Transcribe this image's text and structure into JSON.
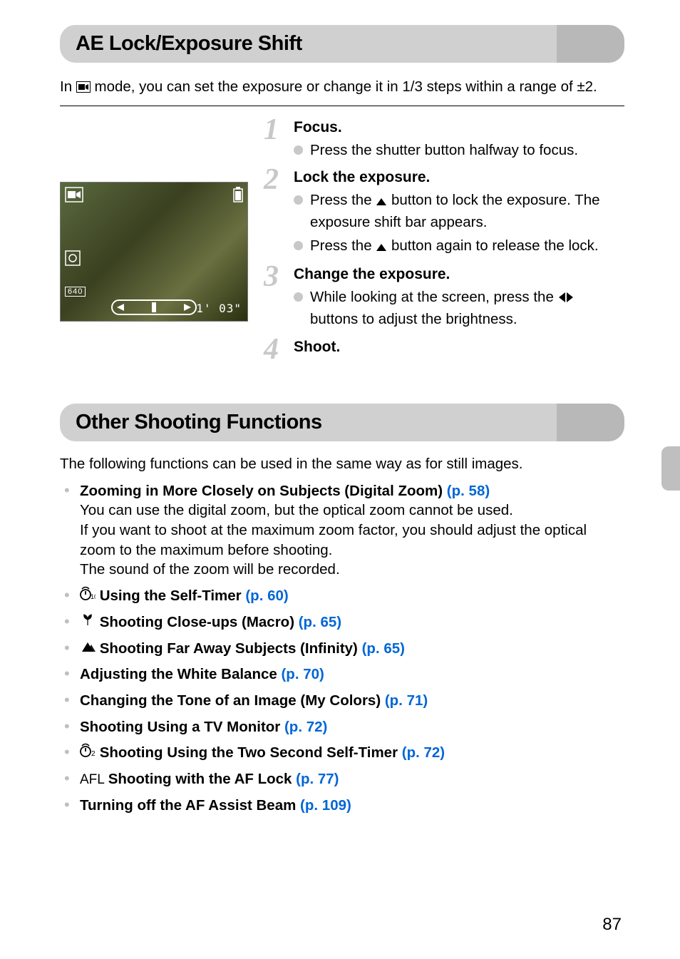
{
  "page_number": "87",
  "section1": {
    "heading": "AE Lock/Exposure Shift",
    "intro_pre": "In ",
    "intro_post": " mode, you can set the exposure or change it in 1/3 steps within a range of ±2.",
    "photo_time": "1' 03\"",
    "steps": [
      {
        "num": "1",
        "title": "Focus.",
        "bullets": [
          {
            "text": "Press the shutter button halfway to focus."
          }
        ]
      },
      {
        "num": "2",
        "title": "Lock the exposure.",
        "bullets": [
          {
            "pre": "Press the ",
            "post": " button to lock the exposure. The exposure shift bar appears.",
            "icon": "up"
          },
          {
            "pre": "Press the ",
            "post": " button again to release the lock.",
            "icon": "up"
          }
        ]
      },
      {
        "num": "3",
        "title": "Change the exposure.",
        "bullets": [
          {
            "pre": "While looking at the screen, press the ",
            "post": " buttons to adjust the brightness.",
            "icon": "leftright"
          }
        ]
      },
      {
        "num": "4",
        "title": "Shoot.",
        "bullets": []
      }
    ]
  },
  "section2": {
    "heading": "Other Shooting Functions",
    "intro": "The following functions can be used in the same way as for still images.",
    "items": [
      {
        "icon": "",
        "title": "Zooming in More Closely on Subjects (Digital Zoom) ",
        "link": "(p. 58)",
        "desc": "You can use the digital zoom, but the optical zoom cannot be used. If you want to shoot at the maximum zoom factor, you should adjust the optical zoom to the maximum before shooting.\nThe sound of the zoom will be recorded."
      },
      {
        "icon": "timer10",
        "title": " Using the Self-Timer ",
        "link": "(p. 60)"
      },
      {
        "icon": "macro",
        "title": " Shooting Close-ups (Macro) ",
        "link": "(p. 65)"
      },
      {
        "icon": "infinity",
        "title": " Shooting Far Away Subjects (Infinity) ",
        "link": "(p. 65)"
      },
      {
        "icon": "",
        "title": "Adjusting the White Balance ",
        "link": "(p. 70)"
      },
      {
        "icon": "",
        "title": "Changing the Tone of an Image (My Colors) ",
        "link": "(p. 71)"
      },
      {
        "icon": "",
        "title": "Shooting Using a TV Monitor ",
        "link": "(p. 72)"
      },
      {
        "icon": "timer2",
        "title": " Shooting Using the Two Second Self-Timer ",
        "link": "(p. 72)"
      },
      {
        "icon": "afl",
        "title": " Shooting with the AF Lock ",
        "link": "(p. 77)"
      },
      {
        "icon": "",
        "title": "Turning off the AF Assist Beam ",
        "link": "(p. 109)"
      }
    ]
  }
}
